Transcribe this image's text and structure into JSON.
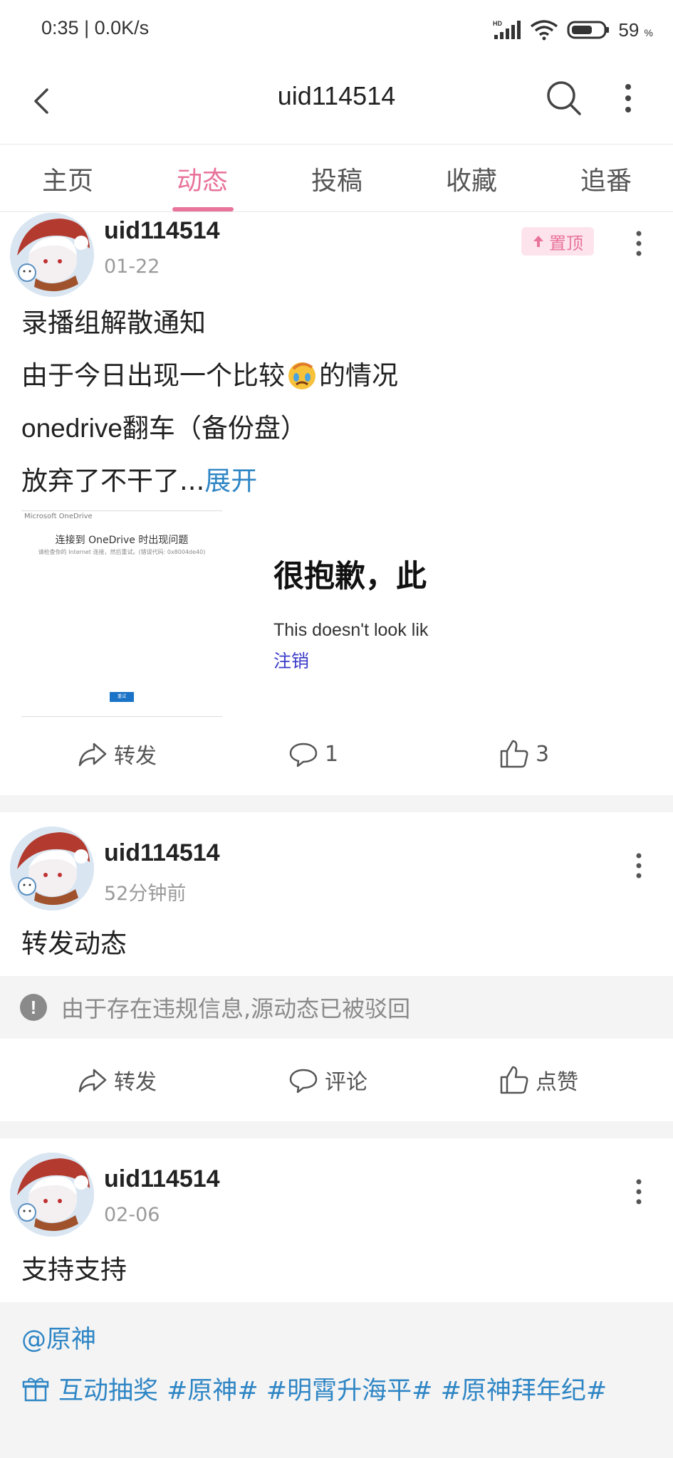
{
  "status_bar": {
    "time": "0:35",
    "net_speed": "0.0K/s",
    "battery_pct": "59",
    "battery_unit": "%",
    "hd_label": "HD"
  },
  "header": {
    "title": "uid114514"
  },
  "tabs": [
    {
      "label": "主页",
      "active": false
    },
    {
      "label": "动态",
      "active": true
    },
    {
      "label": "投稿",
      "active": false
    },
    {
      "label": "收藏",
      "active": false
    },
    {
      "label": "追番",
      "active": false
    }
  ],
  "posts": [
    {
      "user": "uid114514",
      "time": "01-22",
      "pinned_label": "置顶",
      "lines": [
        "录播组解散通知",
        "由于今日出现一个比较",
        "的情况",
        "onedrive翻车（备份盘）",
        "放弃了不干了..."
      ],
      "expand_label": "展开",
      "image_left": {
        "brand": "Microsoft OneDrive",
        "title": "连接到 OneDrive 时出现问题",
        "subtitle": "请检查你的 Internet 连接，然后重试。(错误代码: 0x8004de40)",
        "button": "重试"
      },
      "image_right": {
        "heading": "很抱歉，此",
        "english": "This doesn't look lik",
        "link": "注销"
      },
      "actions": {
        "repost": "转发",
        "comment": "1",
        "like": "3"
      }
    },
    {
      "user": "uid114514",
      "time": "52分钟前",
      "text": "转发动态",
      "blocked_notice": "由于存在违规信息,源动态已被驳回",
      "actions": {
        "repost": "转发",
        "comment": "评论",
        "like": "点赞"
      }
    },
    {
      "user": "uid114514",
      "time": "02-06",
      "text": "支持支持",
      "mention": "@原神",
      "lottery_label": "互动抽奖",
      "topics": "#原神# #明霄升海平# #原神拜年纪#"
    }
  ],
  "colors": {
    "accent": "#e8739b",
    "link": "#2f86c5",
    "separator": "#f4f4f4",
    "muted": "#9a9a9a"
  },
  "icons": [
    "back-icon",
    "search-icon",
    "more-icon",
    "pin-icon",
    "repost-icon",
    "comment-icon",
    "like-icon",
    "warning-icon",
    "gift-icon"
  ]
}
